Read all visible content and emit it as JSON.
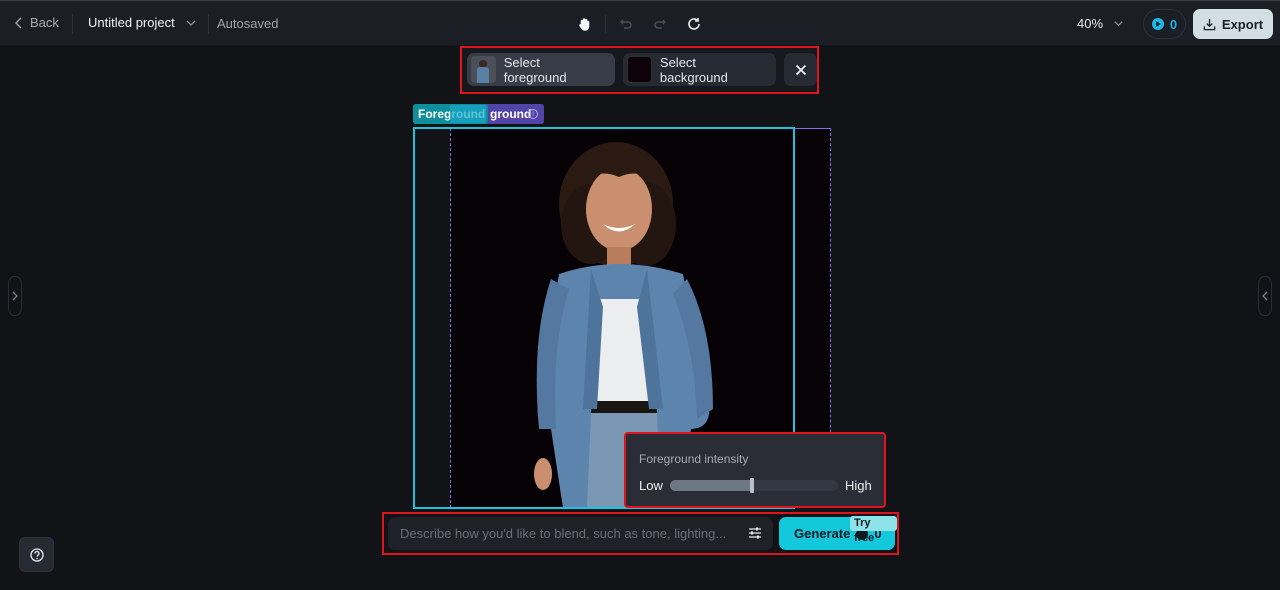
{
  "header": {
    "back_label": "Back",
    "project_title": "Untitled project",
    "save_status": "Autosaved",
    "zoom_level": "40%",
    "credits": "0",
    "export_label": "Export"
  },
  "select_toolbar": {
    "foreground_label": "Select foreground",
    "background_label": "Select background"
  },
  "canvas": {
    "foreground_tag": "Foreground",
    "background_tag": "Background",
    "background_tag_visible": "ground"
  },
  "intensity": {
    "title": "Foreground intensity",
    "low_label": "Low",
    "high_label": "High",
    "value_percent": 49
  },
  "prompt": {
    "placeholder": "Describe how you'd like to blend, such as tone, lighting...",
    "value": "",
    "generate_label": "Generate",
    "generate_cost": "0",
    "try_free_badge": "Try free"
  },
  "colors": {
    "accent": "#14c8dc",
    "foreground_frame": "#1cc3de",
    "background_frame": "#8270e8",
    "highlight": "#e0141e"
  }
}
